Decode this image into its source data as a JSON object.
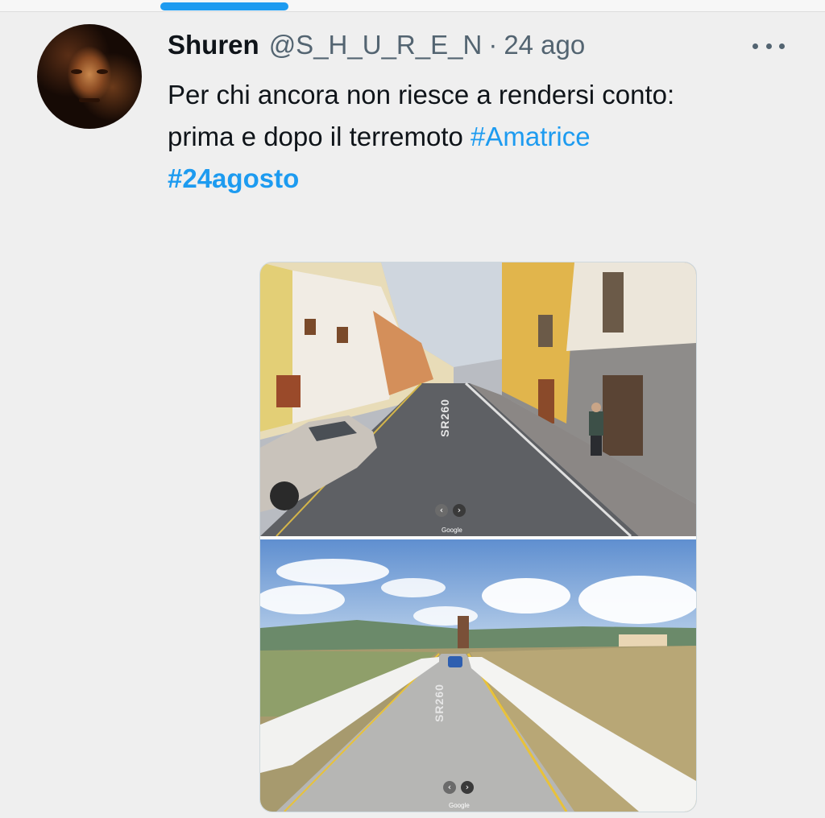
{
  "tweet": {
    "display_name": "Shuren",
    "handle": "@S_H_U_R_E_N",
    "separator": "·",
    "date": "24 ago",
    "text_line1": "Per chi ancora non riesce a rendersi conto:",
    "text_line2_plain": "prima e dopo il terremoto ",
    "hashtag1": "#Amatrice",
    "hashtag2": "#24agosto"
  },
  "media": {
    "top_photo": {
      "watermark": "Google",
      "road_marking": "SR260"
    },
    "bottom_photo": {
      "watermark": "Google",
      "road_marking": "SR260"
    },
    "nav_prev_icon": "‹",
    "nav_next_icon": "›"
  },
  "colors": {
    "accent": "#1d9bf0",
    "text": "#0f1419",
    "secondary": "#536471",
    "background": "#efefef"
  }
}
